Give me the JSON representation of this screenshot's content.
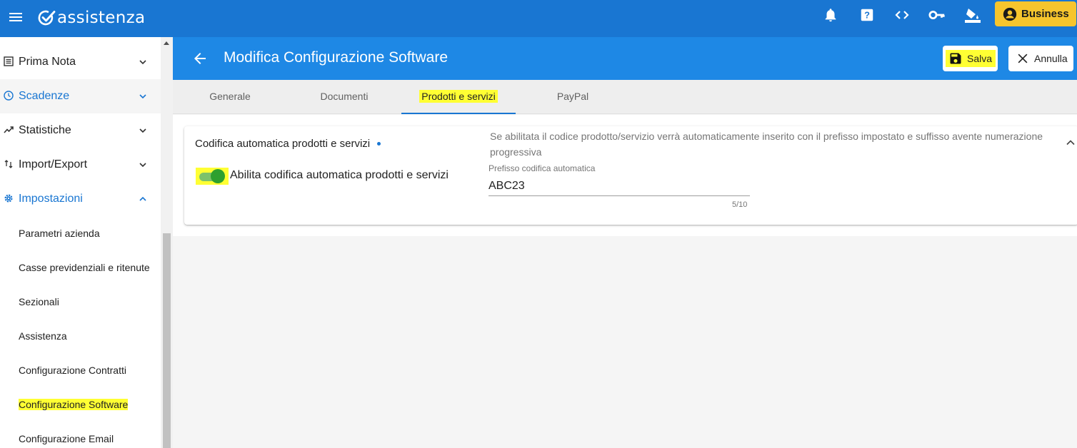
{
  "app": {
    "name": "assistenza"
  },
  "topbar": {
    "icons": [
      "menu-icon",
      "bell-icon",
      "help-icon",
      "code-icon",
      "key-icon",
      "paint-bucket-icon"
    ],
    "business_label": "Business",
    "accent": "#1976d2",
    "business_color": "#f6c52d"
  },
  "sidebar": {
    "items": [
      {
        "label": "Prima Nota",
        "icon": "ledger-icon",
        "expanded": false
      },
      {
        "label": "Scadenze",
        "icon": "clock-icon",
        "expanded": false
      },
      {
        "label": "Statistiche",
        "icon": "trending-up-icon",
        "expanded": false
      },
      {
        "label": "Import/Export",
        "icon": "import-export-icon",
        "expanded": false
      },
      {
        "label": "Impostazioni",
        "icon": "gear-icon",
        "expanded": true
      }
    ],
    "sub_items": [
      "Parametri azienda",
      "Casse previdenziali e ritenute",
      "Sezionali",
      "Assistenza",
      "Configurazione Contratti",
      "Configurazione Software",
      "Configurazione Email"
    ],
    "selected": "Configurazione Software"
  },
  "header": {
    "title": "Modifica Configurazione Software",
    "save_label": "Salva",
    "cancel_label": "Annulla"
  },
  "tabs": {
    "items": [
      "Generale",
      "Documenti",
      "Prodotti e servizi",
      "PayPal"
    ],
    "active": "Prodotti e servizi"
  },
  "section": {
    "title": "Codifica automatica prodotti e servizi",
    "toggle_label": "Abilita codifica automatica prodotti e servizi",
    "toggle_on": true,
    "hint": "Se abilitata il codice prodotto/servizio verrà automaticamente inserito con il prefisso impostato e suffisso avente numerazione progressiva",
    "field_label": "Prefisso codifica automatica",
    "field_value": "ABC23",
    "counter": "5/10"
  }
}
